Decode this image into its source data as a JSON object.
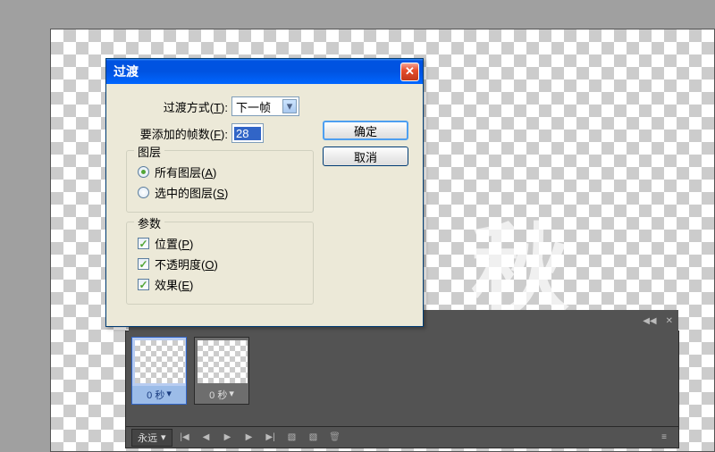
{
  "dialog": {
    "title": "过渡",
    "close": "✕",
    "method_label": "过渡方式(T):",
    "method_value": "下一帧",
    "frames_label": "要添加的帧数(F):",
    "frames_value": "28",
    "ok": "确定",
    "cancel": "取消",
    "layers_group": "图层",
    "radio_all": "所有图层(A)",
    "radio_sel": "选中的图层(S)",
    "params_group": "参数",
    "chk_pos": "位置(P)",
    "chk_opa": "不透明度(O)",
    "chk_fx": "效果(E)"
  },
  "anim": {
    "frame1_time": "0 秒",
    "frame2_time": "0 秒",
    "loop": "永远",
    "arrow_down": "▾",
    "first": "|◀",
    "prev": "◀",
    "play": "▶",
    "next": "▶",
    "last": "▶|",
    "new": "▧",
    "dup": "▧",
    "trash": "🗑",
    "menu": "≡"
  },
  "header": {
    "collapse": "◀◀",
    "close": "✕"
  }
}
